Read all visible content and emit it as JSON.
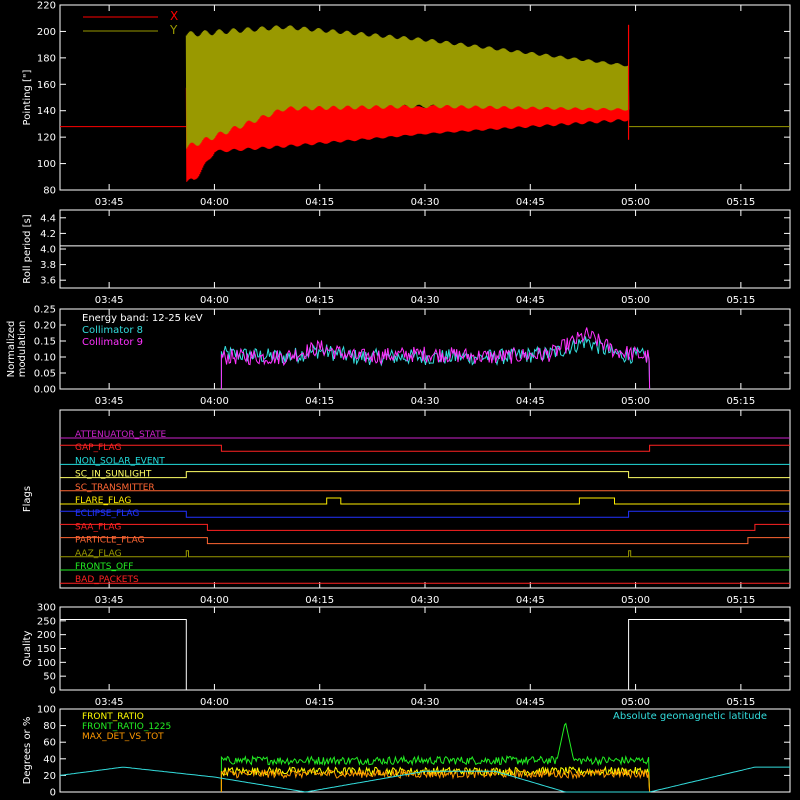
{
  "colors": {
    "background": "#000000",
    "axes": "#ffffff",
    "x_pointing": "#ff0000",
    "y_pointing": "#999900",
    "collimator8": "#33dddd",
    "collimator9": "#ff33ff",
    "front_ratio": "#ffff00",
    "front_ratio_1225": "#22ee22",
    "max_det": "#ff9900",
    "geomag": "#33dddd"
  },
  "chart_data": [
    {
      "type": "line",
      "panel": "pointing",
      "ylabel": "Pointing [\"]",
      "ylim": [
        80,
        220
      ],
      "yticks": [
        "80",
        "100",
        "120",
        "140",
        "160",
        "180",
        "200",
        "220"
      ],
      "xticks": [
        "03:45",
        "04:00",
        "04:15",
        "04:30",
        "04:45",
        "05:00",
        "05:15"
      ],
      "legend": [
        {
          "name": "X",
          "color": "#ff0000"
        },
        {
          "name": "Y",
          "color": "#999900"
        }
      ],
      "baseline": 128,
      "active_start": "03:56",
      "active_end": "04:59",
      "series": [
        {
          "name": "X",
          "upper_envelope": [
            [
              "03:56",
              160
            ],
            [
              "04:02",
              150
            ],
            [
              "04:10",
              152
            ],
            [
              "04:30",
              143
            ],
            [
              "04:59",
              175
            ]
          ],
          "lower_envelope": [
            [
              "03:57",
              85
            ],
            [
              "04:00",
              108
            ],
            [
              "04:10",
              112
            ],
            [
              "04:30",
              122
            ],
            [
              "04:59",
              132
            ]
          ]
        },
        {
          "name": "Y",
          "upper_envelope": [
            [
              "03:56",
              200
            ],
            [
              "04:10",
              205
            ],
            [
              "04:30",
              195
            ],
            [
              "04:59",
              175
            ]
          ],
          "lower_envelope": [
            [
              "03:56",
              110
            ],
            [
              "04:10",
              140
            ],
            [
              "04:30",
              142
            ],
            [
              "04:59",
              140
            ]
          ]
        }
      ]
    },
    {
      "type": "line",
      "panel": "roll",
      "ylabel": "Roll period [s]",
      "ylim": [
        3.5,
        4.5
      ],
      "yticks": [
        "3.6",
        "3.8",
        "4.0",
        "4.2",
        "4.4"
      ],
      "xticks": [
        "03:45",
        "04:00",
        "04:15",
        "04:30",
        "04:45",
        "05:00",
        "05:15"
      ],
      "series": [
        {
          "name": "",
          "values": [
            4.04
          ]
        }
      ]
    },
    {
      "type": "line",
      "panel": "modulation",
      "ylabel": "Normalized modulation",
      "ylim": [
        0,
        0.25
      ],
      "yticks": [
        "0.00",
        "0.05",
        "0.10",
        "0.15",
        "0.20",
        "0.25"
      ],
      "xticks": [
        "03:45",
        "04:00",
        "04:15",
        "04:30",
        "04:45",
        "05:00",
        "05:15"
      ],
      "annotation": "Energy band: 12-25 keV",
      "legend": [
        {
          "name": "Collimator 8",
          "color": "#33dddd"
        },
        {
          "name": "Collimator 9",
          "color": "#ff33ff"
        }
      ],
      "active_start": "04:01",
      "active_end": "05:02",
      "series": [
        {
          "name": "Collimator 8",
          "points": [
            [
              "04:01",
              0.11
            ],
            [
              "04:10",
              0.1
            ],
            [
              "04:15",
              0.12
            ],
            [
              "04:20",
              0.1
            ],
            [
              "04:30",
              0.1
            ],
            [
              "04:40",
              0.1
            ],
            [
              "04:48",
              0.11
            ],
            [
              "04:53",
              0.15
            ],
            [
              "04:57",
              0.11
            ],
            [
              "05:02",
              0.1
            ]
          ]
        },
        {
          "name": "Collimator 9",
          "points": [
            [
              "04:01",
              0.1
            ],
            [
              "04:10",
              0.1
            ],
            [
              "04:15",
              0.13
            ],
            [
              "04:20",
              0.1
            ],
            [
              "04:30",
              0.11
            ],
            [
              "04:40",
              0.1
            ],
            [
              "04:48",
              0.11
            ],
            [
              "04:53",
              0.17
            ],
            [
              "04:57",
              0.12
            ],
            [
              "05:02",
              0.1
            ]
          ]
        }
      ]
    },
    {
      "type": "line",
      "panel": "flags",
      "ylabel": "Flags",
      "xticks": [
        "03:45",
        "04:00",
        "04:15",
        "04:30",
        "04:45",
        "05:00",
        "05:15"
      ],
      "flags": [
        {
          "name": "ATTENUATOR_STATE",
          "color": "#cc22cc",
          "steps": []
        },
        {
          "name": "GAP_FLAG",
          "color": "#ff2222",
          "steps": [
            [
              "03:38",
              1
            ],
            [
              "04:01",
              0
            ],
            [
              "05:02",
              1
            ]
          ]
        },
        {
          "name": "NON_SOLAR_EVENT",
          "color": "#22dddd",
          "steps": []
        },
        {
          "name": "SC_IN_SUNLIGHT",
          "color": "#ffff66",
          "steps": [
            [
              "03:38",
              0
            ],
            [
              "03:56",
              1
            ],
            [
              "04:59",
              0
            ]
          ]
        },
        {
          "name": "SC_TRANSMITTER",
          "color": "#ff6633",
          "steps": []
        },
        {
          "name": "FLARE_FLAG",
          "color": "#ffee00",
          "steps": [
            [
              "03:38",
              0
            ],
            [
              "04:16",
              1
            ],
            [
              "04:18",
              0
            ],
            [
              "04:52",
              1
            ],
            [
              "04:57",
              0
            ]
          ]
        },
        {
          "name": "ECLIPSE_FLAG",
          "color": "#2233ff",
          "steps": [
            [
              "03:38",
              1
            ],
            [
              "03:56",
              0
            ],
            [
              "04:59",
              1
            ]
          ]
        },
        {
          "name": "SAA_FLAG",
          "color": "#ff2222",
          "steps": [
            [
              "03:38",
              1
            ],
            [
              "03:59",
              0
            ],
            [
              "05:17",
              1
            ]
          ]
        },
        {
          "name": "PARTICLE_FLAG",
          "color": "#ff6633",
          "steps": [
            [
              "03:38",
              1
            ],
            [
              "03:59",
              0
            ],
            [
              "05:16",
              1
            ]
          ]
        },
        {
          "name": "AAZ_FLAG",
          "color": "#999900",
          "steps": [
            [
              "03:38",
              0
            ],
            [
              "03:56",
              1
            ],
            [
              "03:56.3",
              0
            ],
            [
              "04:59",
              1
            ],
            [
              "04:59.3",
              0
            ]
          ]
        },
        {
          "name": "FRONTS_OFF",
          "color": "#22ee22",
          "steps": []
        },
        {
          "name": "BAD_PACKETS",
          "color": "#ff2222",
          "steps": []
        }
      ]
    },
    {
      "type": "line",
      "panel": "quality",
      "ylabel": "Quality",
      "ylim": [
        0,
        300
      ],
      "yticks": [
        "0",
        "50",
        "100",
        "150",
        "200",
        "250",
        "300"
      ],
      "xticks": [
        "03:45",
        "04:00",
        "04:15",
        "04:30",
        "04:45",
        "05:00",
        "05:15"
      ],
      "series": [
        {
          "name": "",
          "steps": [
            [
              "03:38",
              255
            ],
            [
              "03:56",
              0
            ],
            [
              "04:59",
              255
            ]
          ]
        }
      ]
    },
    {
      "type": "line",
      "panel": "ratios",
      "ylabel": "Degrees or %",
      "ylim": [
        0,
        100
      ],
      "yticks": [
        "0",
        "20",
        "40",
        "60",
        "80",
        "100"
      ],
      "legend": [
        {
          "name": "FRONT_RATIO",
          "color": "#ffff00"
        },
        {
          "name": "FRONT_RATIO_1225",
          "color": "#22ee22"
        },
        {
          "name": "MAX_DET_VS_TOT",
          "color": "#ff9900"
        }
      ],
      "annotation": "Absolute geomagnetic latitude",
      "active_start": "04:01",
      "active_end": "05:02",
      "series": [
        {
          "name": "FRONT_RATIO",
          "mean": 25
        },
        {
          "name": "FRONT_RATIO_1225",
          "mean": 38,
          "spike": [
            "04:50",
            85
          ]
        },
        {
          "name": "MAX_DET_VS_TOT",
          "mean": 22
        },
        {
          "name": "Absolute geomagnetic latitude",
          "points": [
            [
              "03:38",
              20
            ],
            [
              "03:47",
              30
            ],
            [
              "04:00",
              18
            ],
            [
              "04:13",
              0
            ],
            [
              "04:30",
              25
            ],
            [
              "04:40",
              25
            ],
            [
              "04:50",
              0
            ],
            [
              "05:02",
              0
            ],
            [
              "05:17",
              30
            ]
          ]
        }
      ]
    }
  ]
}
